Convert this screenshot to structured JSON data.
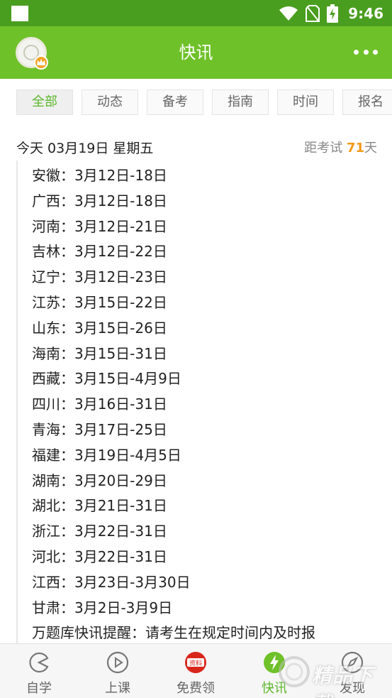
{
  "status_bar": {
    "time": "9:46"
  },
  "app_bar": {
    "title": "快讯"
  },
  "tabs": [
    {
      "label": "全部",
      "active": true
    },
    {
      "label": "动态",
      "active": false
    },
    {
      "label": "备考",
      "active": false
    },
    {
      "label": "指南",
      "active": false
    },
    {
      "label": "时间",
      "active": false
    },
    {
      "label": "报名",
      "active": false
    }
  ],
  "date_line": {
    "today": "今天 03月19日  星期五",
    "countdown_prefix": "距考试",
    "countdown_days": "71",
    "countdown_suffix": "天"
  },
  "entries": [
    "安徽：3月12日-18日",
    "广西：3月12日-18日",
    "河南：3月12日-21日",
    "吉林：3月12日-22日",
    "辽宁：3月12日-23日",
    "江苏：3月15日-22日",
    "山东：3月15日-26日",
    "海南：3月15日-31日",
    "西藏：3月15日-4月9日",
    "四川：3月16日-31日",
    "青海：3月17日-25日",
    "福建：3月19日-4月5日",
    "湖南：3月20日-29日",
    "湖北：3月21日-31日",
    "浙江：3月22日-31日",
    "河北：3月22日-31日",
    "江西：3月23日-3月30日",
    "甘肃：3月2日-3月9日",
    "万题库快讯提醒：请考生在规定时间内及时报"
  ],
  "bottom_nav": [
    {
      "label": "自学",
      "icon": "pacman-icon",
      "active": false
    },
    {
      "label": "上课",
      "icon": "play-circle-icon",
      "active": false
    },
    {
      "label": "免费领",
      "icon": "materials-badge-icon",
      "badge": "资料",
      "active": false
    },
    {
      "label": "快讯",
      "icon": "lightning-icon",
      "active": true
    },
    {
      "label": "发现",
      "icon": "compass-icon",
      "active": false
    }
  ],
  "watermark": {
    "text": "精品下载"
  },
  "colors": {
    "statusbar": "#4a9e1f",
    "appbar": "#6fc129",
    "accent_green": "#5cb72a",
    "countdown_orange": "#f29a1a",
    "badge_red": "#d9261c"
  }
}
